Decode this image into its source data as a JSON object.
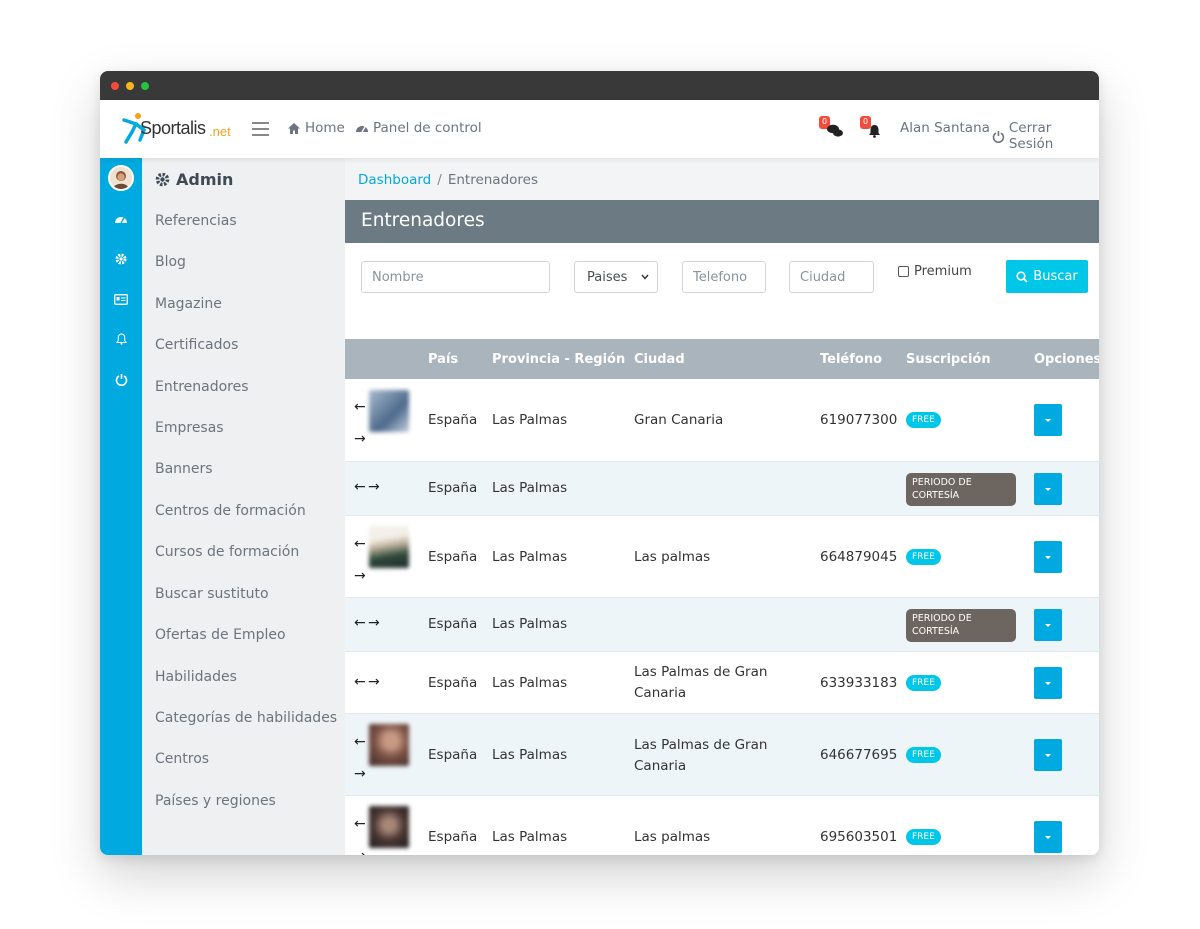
{
  "app": {
    "brand": "Sportalis",
    "tld": ".net"
  },
  "topnav": {
    "home": "Home",
    "panel": "Panel de control",
    "messages_count": "0",
    "alerts_count": "0",
    "user": "Alan Santana",
    "logout": "Cerrar Sesión"
  },
  "sidebar": {
    "title": "Admin",
    "items": [
      "Referencias",
      "Blog",
      "Magazine",
      "Certificados",
      "Entrenadores",
      "Empresas",
      "Banners",
      "Centros de formación",
      "Cursos de formación",
      "Buscar sustituto",
      "Ofertas de Empleo",
      "Habilidades",
      "Categorías de habilidades",
      "Centros",
      "Países y regiones"
    ]
  },
  "breadcrumb": {
    "root": "Dashboard",
    "current": "Entrenadores"
  },
  "page": {
    "title": "Entrenadores"
  },
  "filters": {
    "nombre_placeholder": "Nombre",
    "paises_selected": "Paises",
    "telefono_placeholder": "Telefono",
    "ciudad_placeholder": "Ciudad",
    "premium_label": "Premium",
    "search_label": "Buscar"
  },
  "table": {
    "headers": [
      "País",
      "Provincia - Región",
      "Ciudad",
      "Teléfono",
      "Suscripción",
      "Opciones"
    ],
    "rows": [
      {
        "pais": "España",
        "provincia": "Las Palmas",
        "ciudad": "Gran Canaria",
        "telefono": "619077300",
        "suscripcion": "FREE"
      },
      {
        "pais": "España",
        "provincia": "Las Palmas",
        "ciudad": "",
        "telefono": "",
        "suscripcion": "PERIODO DE CORTESÍA"
      },
      {
        "pais": "España",
        "provincia": "Las Palmas",
        "ciudad": "Las palmas",
        "telefono": "664879045",
        "suscripcion": "FREE"
      },
      {
        "pais": "España",
        "provincia": "Las Palmas",
        "ciudad": "",
        "telefono": "",
        "suscripcion": "PERIODO DE CORTESÍA"
      },
      {
        "pais": "España",
        "provincia": "Las Palmas",
        "ciudad": "Las Palmas de Gran Canaria",
        "telefono": "633933183",
        "suscripcion": "FREE"
      },
      {
        "pais": "España",
        "provincia": "Las Palmas",
        "ciudad": "Las Palmas de Gran Canaria",
        "telefono": "646677695",
        "suscripcion": "FREE"
      },
      {
        "pais": "España",
        "provincia": "Las Palmas",
        "ciudad": "Las palmas",
        "telefono": "695603501",
        "suscripcion": "FREE"
      }
    ]
  },
  "colors": {
    "accent": "#00a9e0",
    "free_badge": "#00c6e8",
    "courtesy_badge": "#6d655f",
    "title_bar": "#6c7a84",
    "table_head": "#a9b4bc"
  },
  "icons": [
    "home-icon",
    "dashboard-icon",
    "chat-icon",
    "bell-icon",
    "power-icon",
    "gear-icon",
    "id-card-icon",
    "search-icon",
    "arrow-left-icon",
    "arrow-right-icon"
  ]
}
